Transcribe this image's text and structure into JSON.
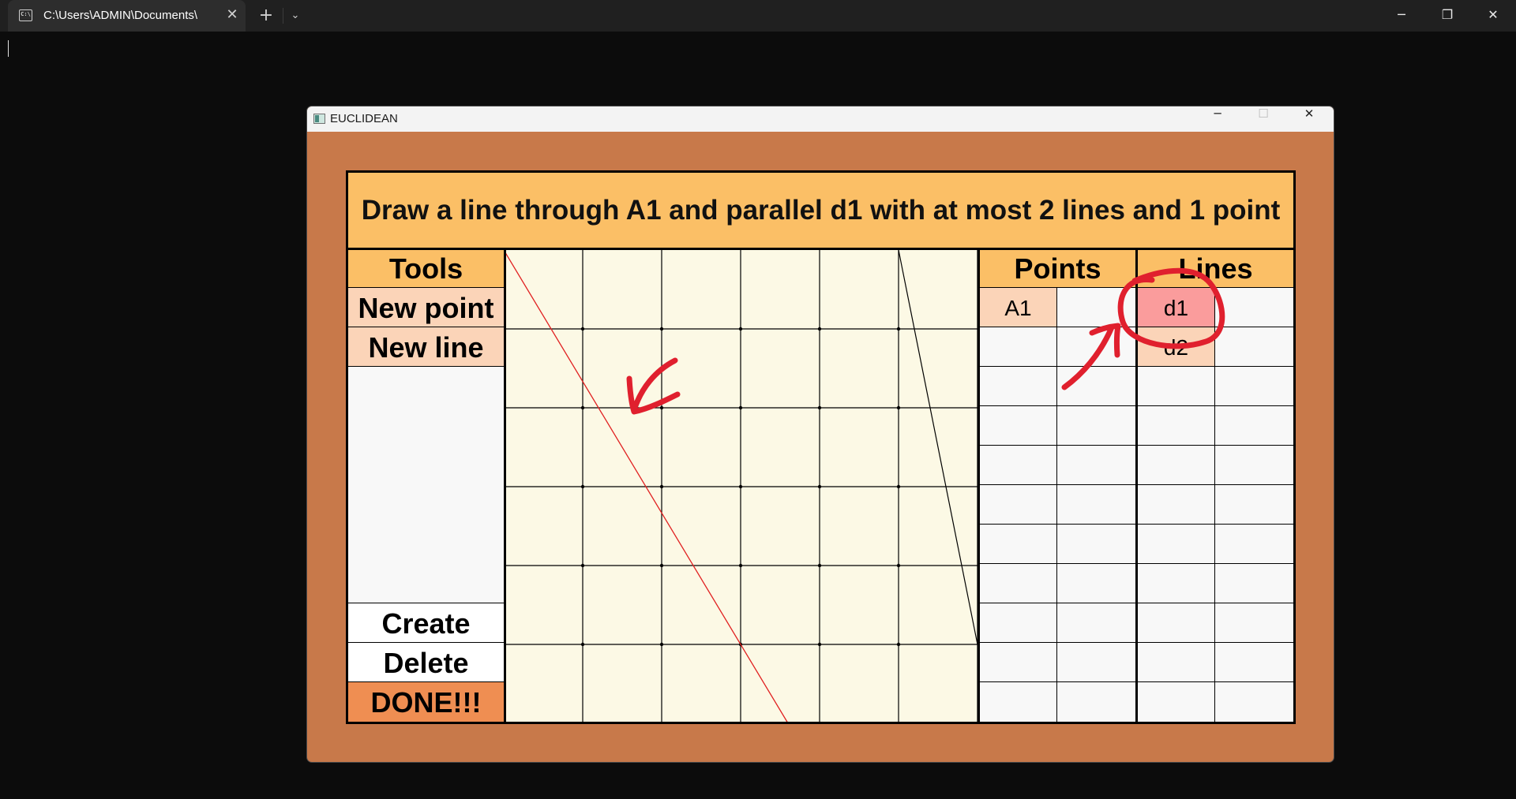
{
  "terminal": {
    "tab_title": "C:\\Users\\ADMIN\\Documents\\",
    "tab_icon": "terminal-icon",
    "new_tab": "+",
    "close": "✕"
  },
  "window": {
    "title": "EUCLIDEAN",
    "icon": "app-icon"
  },
  "game": {
    "task": "Draw a line through A1 and parallel d1 with at most 2 lines and 1 point",
    "tools_header": "Tools",
    "tools": [
      "New point",
      "New line"
    ],
    "actions": [
      "Create",
      "Delete",
      "DONE!!!"
    ],
    "points_header": "Points",
    "points": [
      "A1"
    ],
    "lines_header": "Lines",
    "lines": [
      "d1",
      "d2"
    ],
    "selected_line": "d1",
    "colors": {
      "background": "#c8794a",
      "header": "#fbbf66",
      "tool_button": "#fbd4b8",
      "done_button": "#ef8e52",
      "selected": "#fa9c9c",
      "grid_background": "#fcf9e5",
      "line_d1": "#e02020",
      "line_d2": "#000000",
      "annotation": "#e0202e"
    }
  }
}
